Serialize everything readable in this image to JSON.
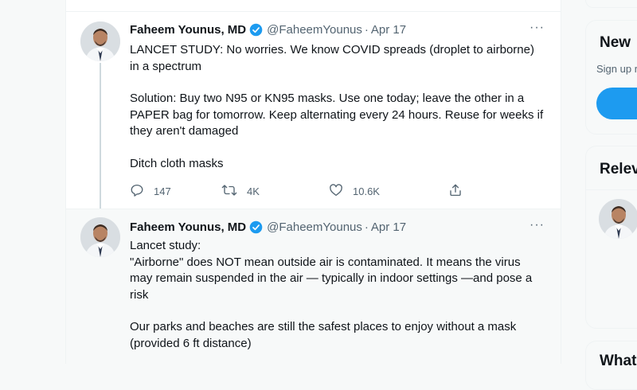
{
  "tweets": [
    {
      "name": "Faheem Younus, MD",
      "handle": "@FaheemYounus",
      "separator": "·",
      "date": "Apr 17",
      "more": "···",
      "paragraphs": [
        "LANCET STUDY: No worries. We know COVID spreads (droplet to airborne) in a spectrum",
        "Solution: Buy two N95 or KN95 masks. Use one today; leave the other in a PAPER bag for tomorrow. Keep alternating every 24 hours. Reuse for weeks if they aren't damaged",
        "Ditch cloth masks"
      ],
      "actions": {
        "replies": "147",
        "retweets": "4K",
        "likes": "10.6K"
      }
    },
    {
      "name": "Faheem Younus, MD",
      "handle": "@FaheemYounus",
      "separator": "·",
      "date": "Apr 17",
      "more": "···",
      "lines": [
        "Lancet study:",
        "\"Airborne\" does NOT mean outside air is contaminated. It means the virus may remain suspended in the air — typically in indoor settings —and pose a risk"
      ],
      "paragraph2": "Our parks and beaches are still the safest places to enjoy without a mask (provided 6 ft distance)"
    }
  ],
  "sidebar": {
    "new_title": "New",
    "signup_text": "Sign up r",
    "relevant_title": "Relev",
    "whats_title": "What's"
  },
  "colors": {
    "accent": "#1d9bf0",
    "text": "#0f1419",
    "secondary": "#536471",
    "border": "#eff3f4"
  },
  "icons": {
    "verified": "verified-badge-icon",
    "reply": "reply-icon",
    "retweet": "retweet-icon",
    "like": "heart-icon",
    "share": "share-icon",
    "more": "more-icon"
  }
}
